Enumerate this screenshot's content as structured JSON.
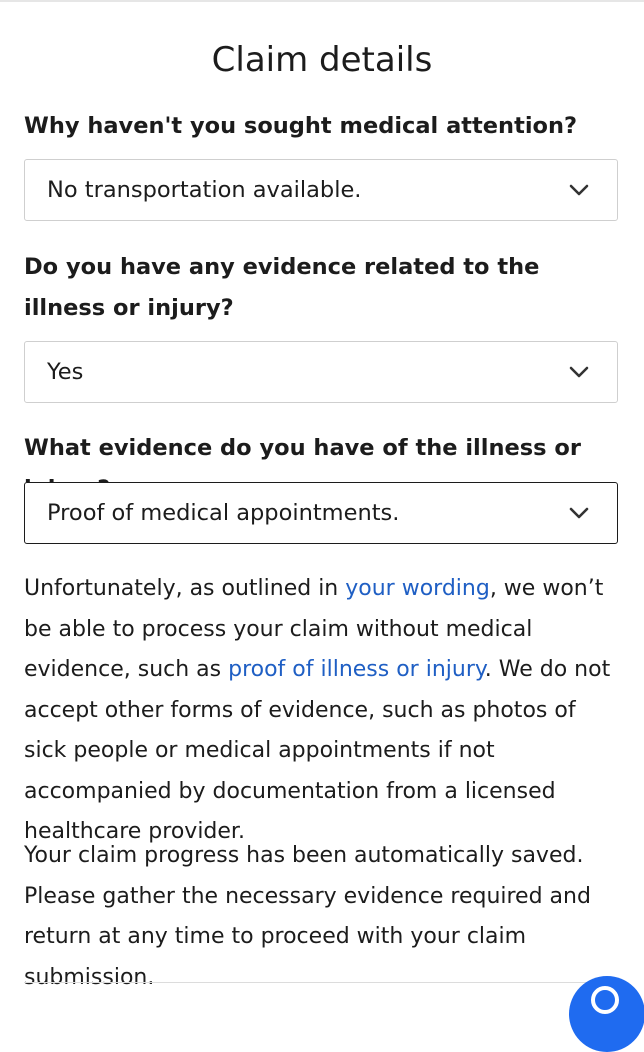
{
  "page": {
    "title": "Claim details"
  },
  "questions": [
    {
      "label": "Why haven't you sought medical attention?",
      "selected": "No transportation available."
    },
    {
      "label": "Do you have any evidence related to the illness or injury?",
      "selected": "Yes"
    },
    {
      "label": "What evidence do you have of the illness or injury?",
      "selected": "Proof of medical appointments."
    }
  ],
  "notice": {
    "part1": "Unfortunately, as outlined in ",
    "link1": "your wording",
    "part2": ", we won’t be able to process your claim without medical evidence, such as ",
    "link2": "proof of illness or injury",
    "part3": ". We do not accept other forms of evidence, such as photos of sick people or medical appointments if not accompanied by documentation from a licensed healthcare provider."
  },
  "saved_message": "Your claim progress has been automatically saved. Please gather the necessary evidence required and return at any time to proceed with your claim submission.",
  "icons": {
    "dropdown": "chevron-down-icon",
    "fab": "chat-help-icon"
  },
  "colors": {
    "link": "#1f5fc4",
    "fab": "#1f6bf0",
    "text": "#1c1c1c"
  }
}
